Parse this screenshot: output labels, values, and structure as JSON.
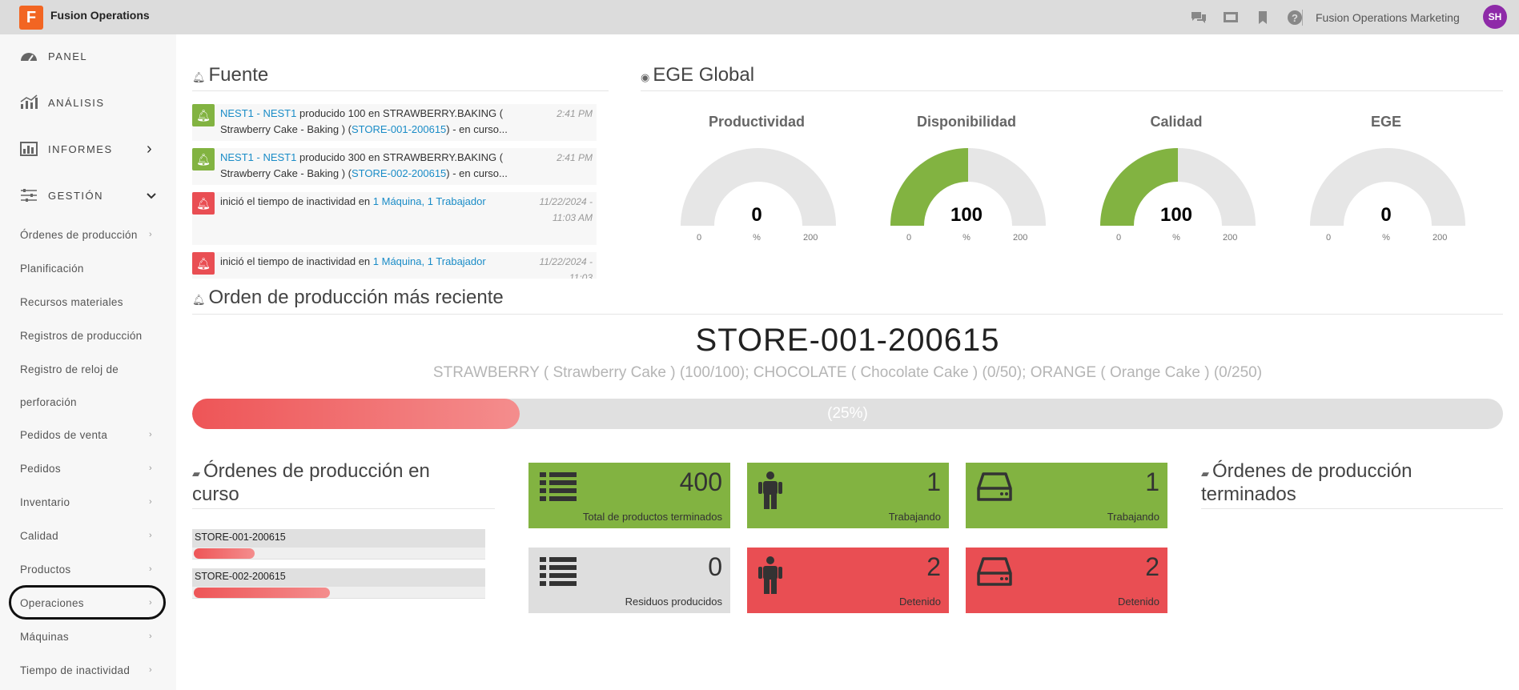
{
  "header": {
    "logo_letter": "F",
    "app_title": "Fusion Operations",
    "org_name": "Fusion Operations Marketing",
    "avatar_initials": "SH",
    "icons": [
      "chat-icon",
      "presentation-icon",
      "bookmark-icon",
      "help-icon"
    ]
  },
  "sidebar": {
    "main": [
      {
        "label": "PANEL",
        "icon": "dashboard-gauge-icon"
      },
      {
        "label": "ANÁLISIS",
        "icon": "bar-chart-icon"
      },
      {
        "label": "INFORMES",
        "icon": "report-icon",
        "chevron": "›"
      },
      {
        "label": "GESTIÓN",
        "icon": "sliders-icon",
        "chevron": "⌄"
      }
    ],
    "sub": [
      {
        "label": "Órdenes de producción",
        "chevron": "›"
      },
      {
        "label": "Planificación",
        "chevron": ""
      },
      {
        "label": "Recursos materiales",
        "chevron": ""
      },
      {
        "label": "Registros de producción",
        "chevron": ""
      },
      {
        "label": "Registro de reloj de",
        "chevron": ""
      },
      {
        "label": "perforación",
        "chevron": ""
      },
      {
        "label": "Pedidos de venta",
        "chevron": "›"
      },
      {
        "label": "Pedidos",
        "chevron": "›"
      },
      {
        "label": "Inventario",
        "chevron": "›"
      },
      {
        "label": "Calidad",
        "chevron": "›"
      },
      {
        "label": "Productos",
        "chevron": "›"
      },
      {
        "label": "Operaciones",
        "chevron": "›"
      },
      {
        "label": "Máquinas",
        "chevron": "›"
      },
      {
        "label": "Tiempo de inactividad",
        "chevron": "›"
      }
    ]
  },
  "feed": {
    "title": "Fuente",
    "items": [
      {
        "status": "green",
        "link1": "NEST1 - NEST1",
        "text1": " producido 100 en STRAWBERRY.BAKING ( Strawberry Cake - Baking ) (",
        "link2": "STORE-001-200615",
        "text2": ") - en curso...",
        "time": "2:41 PM"
      },
      {
        "status": "green",
        "link1": "NEST1 - NEST1",
        "text1": " producido 300 en STRAWBERRY.BAKING ( Strawberry Cake - Baking ) (",
        "link2": "STORE-002-200615",
        "text2": ") - en curso...",
        "time": "2:41 PM"
      },
      {
        "status": "red",
        "link1": "",
        "text1": "inició el tiempo de inactividad en ",
        "link2": "1 Máquina, 1 Trabajador",
        "text2": "",
        "time": "11/22/2024 - 11:03 AM"
      },
      {
        "status": "red",
        "link1": "",
        "text1": "inició el tiempo de inactividad en ",
        "link2": "1 Máquina, 1 Trabajador",
        "text2": "",
        "time": "11/22/2024 - 11:03"
      }
    ]
  },
  "ege": {
    "title": "EGE Global",
    "gauges": [
      {
        "title": "Productividad",
        "value": 0,
        "value_text": "0",
        "min": "0",
        "max": "200",
        "unit": "%"
      },
      {
        "title": "Disponibilidad",
        "value": 100,
        "value_text": "100",
        "min": "0",
        "max": "200",
        "unit": "%"
      },
      {
        "title": "Calidad",
        "value": 100,
        "value_text": "100",
        "min": "0",
        "max": "200",
        "unit": "%"
      },
      {
        "title": "EGE",
        "value": 0,
        "value_text": "0",
        "min": "0",
        "max": "200",
        "unit": "%"
      }
    ],
    "fill_color": "#82b341",
    "track_color": "#e6e6e6"
  },
  "recent_order": {
    "title": "Orden de producción más reciente",
    "id": "STORE-001-200615",
    "description": "STRAWBERRY ( Strawberry Cake ) (100/100); CHOCOLATE ( Chocolate Cake ) (0/50); ORANGE ( Orange Cake ) (0/250)",
    "progress": 0.25,
    "progress_text": "(25%)"
  },
  "in_progress": {
    "title": "Órdenes de producción en curso",
    "items": [
      {
        "name": "STORE-001-200615",
        "progress": 0.21
      },
      {
        "name": "STORE-002-200615",
        "progress": 0.47
      }
    ]
  },
  "tiles": [
    {
      "color": "green",
      "icon": "list-icon",
      "number": "400",
      "label": "Total de productos terminados"
    },
    {
      "color": "green",
      "icon": "person-icon",
      "number": "1",
      "label": "Trabajando"
    },
    {
      "color": "green",
      "icon": "hard-drive-icon",
      "number": "1",
      "label": "Trabajando"
    },
    {
      "color": "gray",
      "icon": "list-icon",
      "number": "0",
      "label": "Residuos producidos"
    },
    {
      "color": "red",
      "icon": "person-icon",
      "number": "2",
      "label": "Detenido"
    },
    {
      "color": "red",
      "icon": "hard-drive-icon",
      "number": "2",
      "label": "Detenido"
    }
  ],
  "finished": {
    "title": "Órdenes de producción terminados"
  }
}
